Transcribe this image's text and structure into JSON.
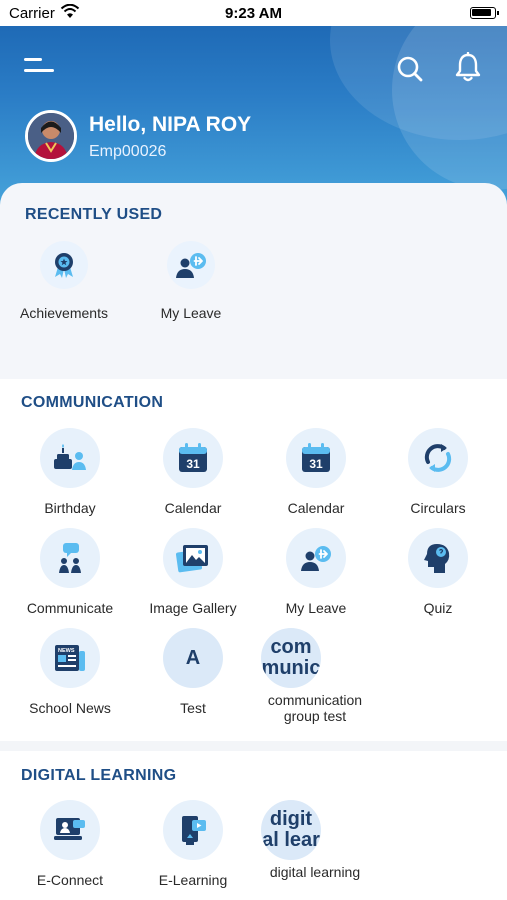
{
  "status_bar": {
    "carrier": "Carrier",
    "time": "9:23 AM"
  },
  "header": {
    "greeting": "Hello, NIPA ROY",
    "employee_id": "Emp00026"
  },
  "recently_used": {
    "title": "RECENTLY USED",
    "items": [
      {
        "label": "Achievements",
        "icon": "achievement-badge-icon"
      },
      {
        "label": "My Leave",
        "icon": "my-leave-icon"
      }
    ]
  },
  "communication": {
    "title": "COMMUNICATION",
    "items": [
      {
        "label": "Birthday",
        "icon": "birthday-cake-icon"
      },
      {
        "label": "Calendar",
        "icon": "calendar-icon",
        "day": "31"
      },
      {
        "label": "Calendar",
        "icon": "calendar-icon",
        "day": "31"
      },
      {
        "label": "Circulars",
        "icon": "circular-arrows-icon"
      },
      {
        "label": "Communicate",
        "icon": "communicate-people-icon"
      },
      {
        "label": "Image Gallery",
        "icon": "image-gallery-icon"
      },
      {
        "label": "My Leave",
        "icon": "my-leave-icon"
      },
      {
        "label": "Quiz",
        "icon": "quiz-head-icon"
      },
      {
        "label": "School News",
        "icon": "newspaper-icon",
        "news_tag": "NEWS"
      },
      {
        "label": "Test",
        "icon": "letter-a-icon",
        "letter": "A"
      },
      {
        "label": "communication\ngroup test",
        "icon": "text-thumbnail-icon",
        "thumb_text": "com\nmunic"
      }
    ]
  },
  "digital_learning": {
    "title": "DIGITAL LEARNING",
    "items": [
      {
        "label": "E-Connect",
        "icon": "e-connect-icon"
      },
      {
        "label": "E-Learning",
        "icon": "e-learning-icon"
      },
      {
        "label": "digital learning",
        "icon": "text-thumbnail-icon",
        "thumb_text": "digit\nal lear"
      }
    ]
  },
  "colors": {
    "header_top": "#1a63b0",
    "header_bottom": "#48a6dc",
    "title": "#1f4e86",
    "icon_dark": "#1f3f6a",
    "icon_accent": "#5bbcf0"
  }
}
